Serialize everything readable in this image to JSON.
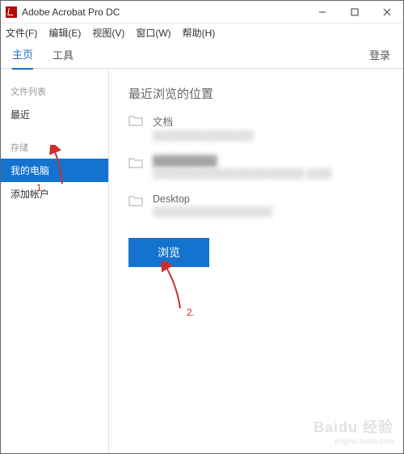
{
  "titlebar": {
    "title": "Adobe Acrobat Pro DC"
  },
  "menubar": {
    "file": "文件(F)",
    "edit": "编辑(E)",
    "view": "视图(V)",
    "window": "窗口(W)",
    "help": "帮助(H)"
  },
  "tabs": {
    "home": "主页",
    "tools": "工具",
    "login": "登录"
  },
  "sidebar": {
    "group_files": "文件列表",
    "recent": "最近",
    "group_storage": "存储",
    "my_computer": "我的电脑",
    "add_account": "添加帐户"
  },
  "content": {
    "title": "最近浏览的位置",
    "loc1": {
      "name": "文档",
      "sub": ""
    },
    "loc2": {
      "name": "——",
      "sub": "——"
    },
    "loc3": {
      "name": "Desktop",
      "sub": ""
    },
    "browse": "浏览"
  },
  "annot": {
    "one": "1.",
    "two": "2."
  },
  "watermark": {
    "main": "Baidu 经验",
    "sub": "jingyan.baidu.com"
  }
}
